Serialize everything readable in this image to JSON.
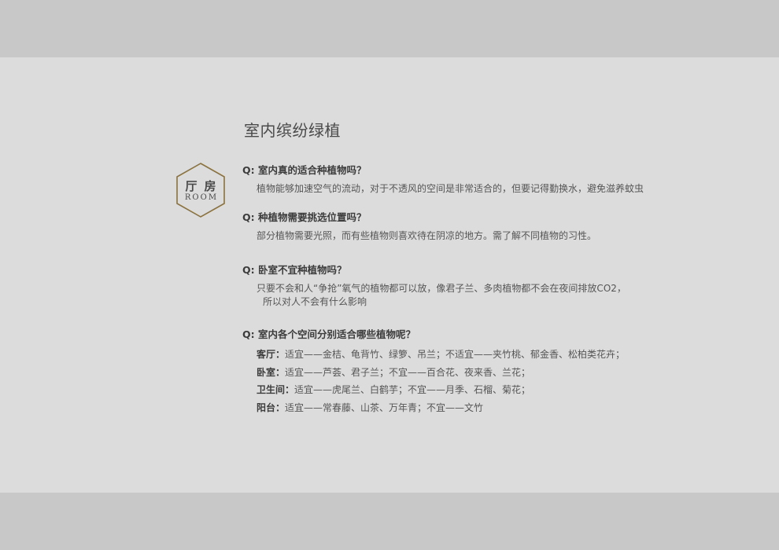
{
  "title": "室内缤纷绿植",
  "badge": {
    "main": "厅房",
    "sub": "ROOM",
    "stroke_color": "#8a7240"
  },
  "faq": [
    {
      "question": "Q: 室内真的适合种植物吗？",
      "answer_lines": [
        "植物能够加速空气的流动，对于不透风的空间是非常适合的，但要记得勤换水，避免滋养蚊虫"
      ]
    },
    {
      "question": "Q: 种植物需要挑选位置吗？",
      "answer_lines": [
        "部分植物需要光照，而有些植物则喜欢待在阴凉的地方。需了解不同植物的习性。"
      ]
    },
    {
      "question": "Q: 卧室不宜种植物吗？",
      "answer_lines": [
        "只要不会和人“争抢”氧气的植物都可以放，像君子兰、多肉植物都不会在夜间排放CO2，",
        "所以对人不会有什么影响"
      ]
    },
    {
      "question": "Q: 室内各个空间分别适合哪些植物呢？",
      "rooms": [
        {
          "label": "客厅：",
          "text": "适宜——金桔、龟背竹、绿箩、吊兰；不适宜——夹竹桃、郁金香、松柏类花卉；"
        },
        {
          "label": "卧室：",
          "text": "适宜——芦荟、君子兰；不宜——百合花、夜来香、兰花；"
        },
        {
          "label": "卫生间：",
          "text": "适宜——虎尾兰、白鹤芋；不宜——月季、石榴、菊花；"
        },
        {
          "label": "阳台：",
          "text": "适宜——常春藤、山茶、万年青；不宜——文竹"
        }
      ]
    }
  ]
}
